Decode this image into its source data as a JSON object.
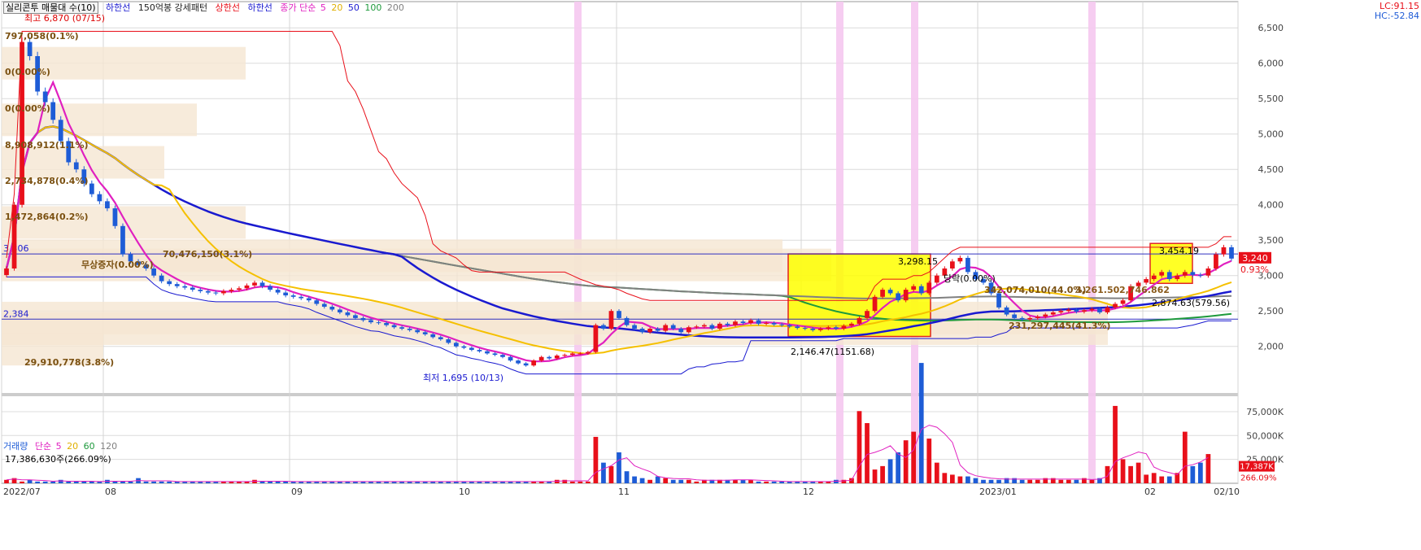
{
  "legend": {
    "stock_box": "실리콘투 매물대 수(10)",
    "lower_band": "하한선",
    "pattern_box": "150억봉 강세패턴",
    "upper_line": "상한선",
    "lower_line": "하한선",
    "ma_title": "종가 단순",
    "ma_periods": [
      "5",
      "20",
      "50",
      "100",
      "200"
    ]
  },
  "volume_legend": {
    "title": "거래량",
    "ma_title": "단순",
    "ma_periods": [
      "5",
      "20",
      "60",
      "120"
    ],
    "current": "17,386,630주(266.09%)"
  },
  "right_top": {
    "lc": "LC:91.15",
    "hc": "HC:-52.84"
  },
  "price_tag": {
    "value": "3,240",
    "pct": "0.93%"
  },
  "volume_tag": {
    "value": "17,387K",
    "pct": "266.09%"
  },
  "colors": {
    "up": "#e8101a",
    "down": "#1e5cd6",
    "ma5": "#e020c0",
    "ma20": "#f5c000",
    "ma50": "#1a1ad0",
    "ma100": "#1e9a3c",
    "ma200": "#808080",
    "highlight": "#f5c8f0",
    "box_fill": "#ffff00",
    "profile": "#f5e6d2"
  },
  "chart_data": [
    {
      "type": "candlestick",
      "y_axis": {
        "ticks": [
          "6,500",
          "6,000",
          "5,500",
          "5,000",
          "4,500",
          "4,000",
          "3,500",
          "3,000",
          "2,500",
          "2,000"
        ],
        "range": [
          1330,
          6870
        ]
      },
      "x_axis": {
        "ticks": [
          "2022/07",
          "08",
          "09",
          "10",
          "11",
          "12",
          "2023/01",
          "02",
          "02/10"
        ]
      },
      "volume_profile_labels": [
        "797,058(0.1%)",
        "0(0.00%)",
        "0(0.00%)",
        "8,908,912(1.1%)",
        "2,734,878(0.4%)",
        "1,472,864(0.2%)",
        "70,476,150(3.1%)",
        "무상증자(0.00%)",
        "29,910,778(3.8%)",
        "342,074,010(44.0%)",
        "231,297,445(41.3%)"
      ],
      "annotations": [
        "최고 6,870 (07/15)",
        "최저 1,695 (10/13)",
        "3,298.15",
        "3,454.19",
        "2,146.47(1151.68)",
        "2,874.63(579.56)",
        "3,261.50",
        "2,746.862",
        "당락(0.00%)"
      ],
      "horizontal_levels": [
        "3,306",
        "2,384"
      ],
      "closes": [
        3100,
        4000,
        6300,
        6100,
        5600,
        5450,
        5200,
        4900,
        4600,
        4500,
        4300,
        4150,
        4050,
        3950,
        3700,
        3300,
        3200,
        3150,
        3100,
        3000,
        2920,
        2880,
        2850,
        2830,
        2800,
        2780,
        2760,
        2750,
        2780,
        2800,
        2820,
        2860,
        2900,
        2850,
        2800,
        2760,
        2720,
        2700,
        2680,
        2650,
        2600,
        2560,
        2520,
        2480,
        2440,
        2400,
        2370,
        2340,
        2330,
        2300,
        2270,
        2250,
        2230,
        2200,
        2170,
        2130,
        2100,
        2050,
        2000,
        1980,
        1950,
        1930,
        1900,
        1880,
        1850,
        1800,
        1760,
        1730,
        1800,
        1850,
        1830,
        1870,
        1880,
        1900,
        1900,
        1920,
        2300,
        2250,
        2500,
        2400,
        2300,
        2250,
        2200,
        2250,
        2220,
        2300,
        2250,
        2200,
        2270,
        2280,
        2300,
        2250,
        2320,
        2300,
        2350,
        2330,
        2370,
        2320,
        2330,
        2310,
        2300,
        2280,
        2260,
        2250,
        2230,
        2250,
        2270,
        2250,
        2290,
        2320,
        2400,
        2500,
        2700,
        2800,
        2750,
        2650,
        2800,
        2850,
        2750,
        2900,
        3000,
        3100,
        3200,
        3250,
        3050,
        2950,
        2900,
        2750,
        2550,
        2450,
        2400,
        2380,
        2400,
        2420,
        2450,
        2480,
        2500,
        2520,
        2490,
        2510,
        2530,
        2480,
        2550,
        2600,
        2650,
        2850,
        2900,
        2950,
        3000,
        3050,
        2950,
        3000,
        3050,
        3010,
        3000,
        3100,
        3300,
        3400,
        3240
      ],
      "volumes": [
        2,
        3,
        1,
        2,
        1,
        1,
        1,
        2,
        1,
        1,
        1,
        1,
        1,
        2,
        1,
        1,
        1,
        3,
        1,
        1,
        1,
        1,
        1,
        1,
        1,
        1,
        1,
        1,
        1,
        1,
        1,
        1,
        2,
        1,
        1,
        1,
        1,
        1,
        1,
        1,
        1,
        1,
        1,
        1,
        1,
        1,
        1,
        1,
        1,
        1,
        1,
        1,
        1,
        1,
        1,
        1,
        1,
        1,
        1,
        1,
        1,
        1,
        1,
        1,
        1,
        1,
        1,
        1,
        1,
        1,
        1,
        2,
        2,
        1,
        1,
        1,
        27,
        12,
        10,
        18,
        7,
        4,
        3,
        2,
        4,
        3,
        2,
        2,
        2,
        1,
        2,
        2,
        2,
        2,
        2,
        2,
        2,
        1,
        1,
        1,
        1,
        1,
        1,
        1,
        1,
        1,
        1,
        2,
        2,
        3,
        42,
        35,
        8,
        10,
        14,
        18,
        25,
        30,
        70,
        26,
        12,
        6,
        5,
        4,
        4,
        3,
        2,
        2,
        2,
        3,
        3,
        2,
        2,
        2,
        3,
        3,
        2,
        2,
        2,
        3,
        2,
        3,
        10,
        45,
        14,
        10,
        12,
        5,
        6,
        4,
        4,
        6,
        30,
        10,
        12,
        17
      ],
      "volume_axis": {
        "ticks": [
          "75,000K",
          "50,000K",
          "25,000K"
        ],
        "range": [
          0,
          92000
        ]
      }
    }
  ]
}
